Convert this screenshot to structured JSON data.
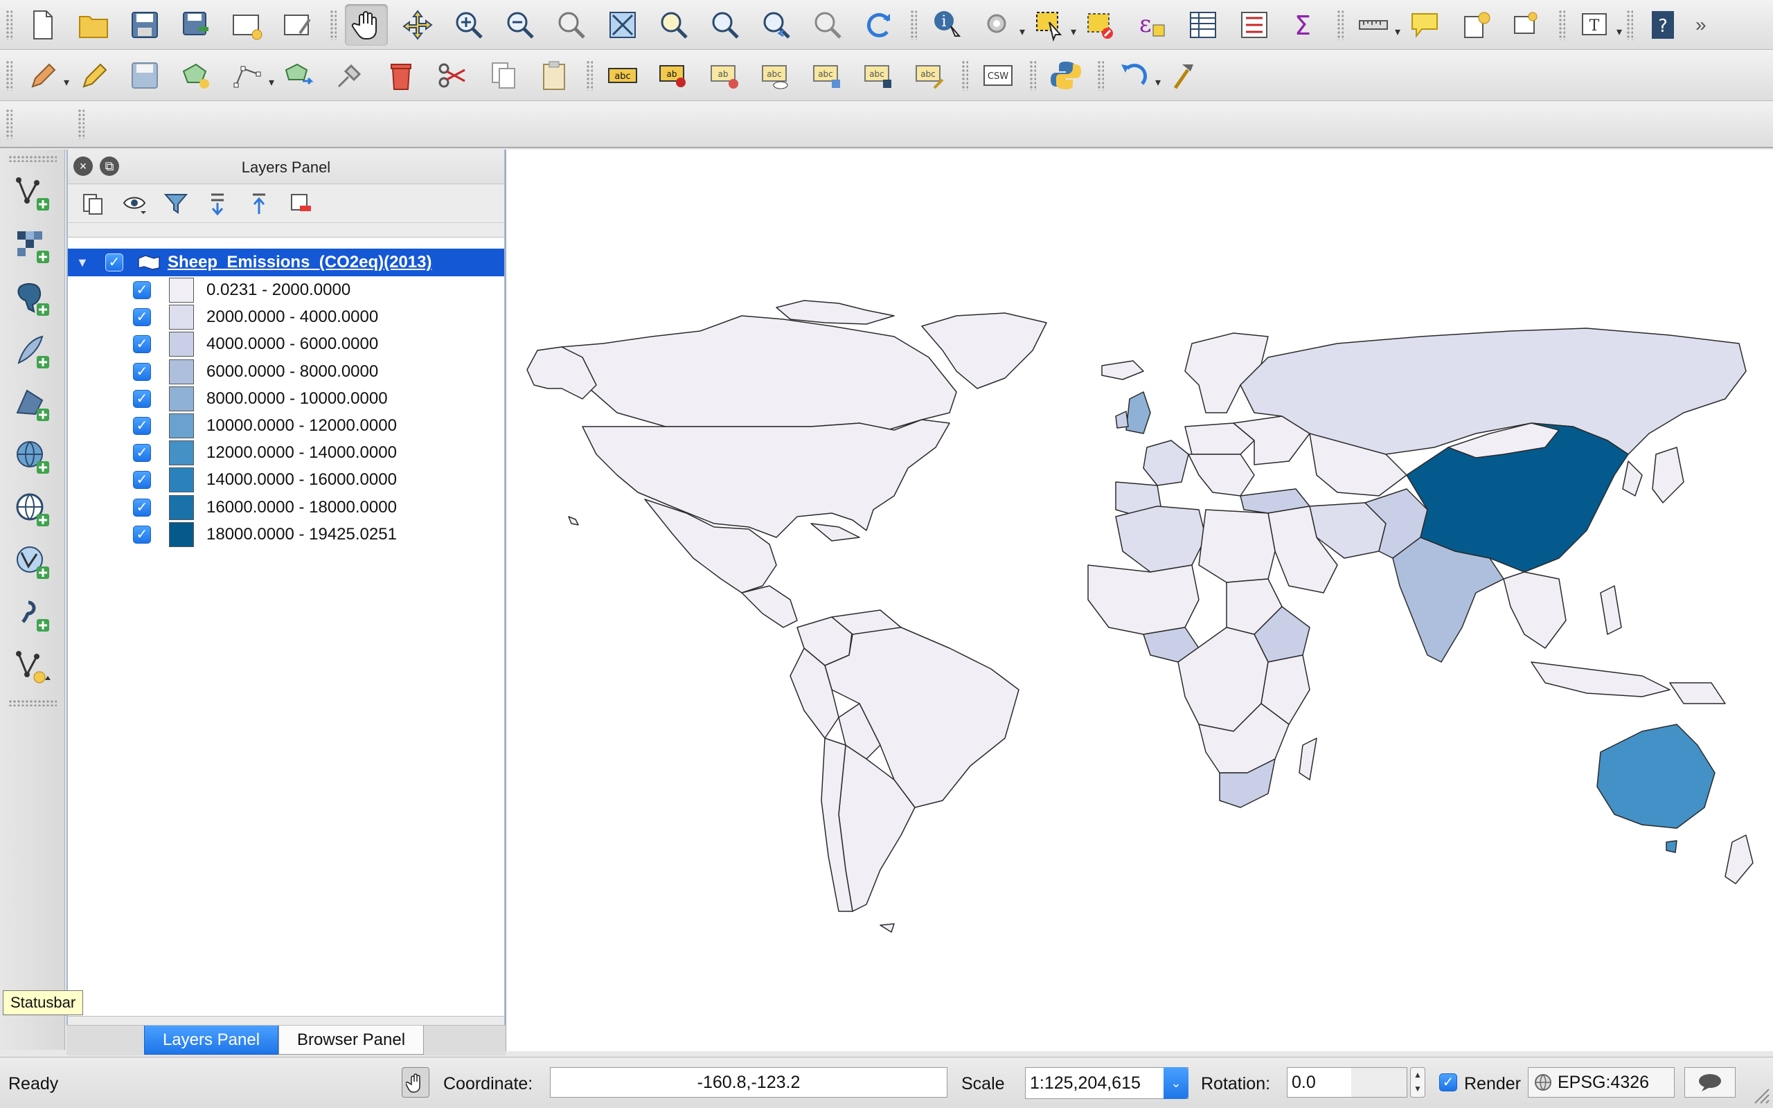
{
  "toolbars": {
    "row1": [
      "new-project",
      "open-project",
      "save-project",
      "save-as",
      "new-print-composer",
      "composer-manager",
      "pan-map",
      "pan-to-selection",
      "zoom-in",
      "zoom-out",
      "zoom-native",
      "zoom-full",
      "zoom-to-selection",
      "zoom-to-layer",
      "zoom-last",
      "zoom-next",
      "refresh",
      "identify",
      "action",
      "select-features",
      "deselect",
      "expression-select",
      "attribute-table",
      "statistical-summary",
      "field-calculator",
      "measure",
      "map-tips",
      "new-bookmark",
      "show-bookmarks",
      "text-annotation",
      "help"
    ],
    "row2": [
      "current-edits",
      "toggle-editing",
      "save-layer-edits",
      "add-feature",
      "node-tool",
      "move-feature",
      "digitize",
      "delete-selected",
      "cut-features",
      "copy-features",
      "paste-features",
      "label-tool",
      "pin-labels",
      "show-hide-labels",
      "move-label",
      "rotate-label",
      "change-label",
      "csw-search",
      "python-console",
      "undo",
      "processing-toolbox"
    ]
  },
  "left_toolbar": [
    "add-vector-layer",
    "add-raster-layer",
    "add-postgis-layer",
    "add-spatialite-layer",
    "add-mssql-layer",
    "add-wms-layer",
    "add-wcs-layer",
    "add-wfs-layer",
    "add-delimited-text-layer",
    "new-shapefile-layer"
  ],
  "layers_panel": {
    "title": "Layers Panel",
    "toolbar": [
      "add-group",
      "manage-visibility",
      "filter-legend",
      "expand-all",
      "collapse-all",
      "remove-layer"
    ],
    "layer": {
      "name": "Sheep_Emissions_(CO2eq)(2013)",
      "checked": true,
      "legend": [
        {
          "label": "0.0231 - 2000.0000",
          "color": "#f1eef6"
        },
        {
          "label": "2000.0000 - 4000.0000",
          "color": "#dddfef"
        },
        {
          "label": "4000.0000 - 6000.0000",
          "color": "#c9cfe6"
        },
        {
          "label": "6000.0000 - 8000.0000",
          "color": "#aebfde"
        },
        {
          "label": "8000.0000 - 10000.0000",
          "color": "#8fb1d6"
        },
        {
          "label": "10000.0000 - 12000.0000",
          "color": "#6aa2cf"
        },
        {
          "label": "12000.0000 - 14000.0000",
          "color": "#4391c6"
        },
        {
          "label": "14000.0000 - 16000.0000",
          "color": "#2a82bd"
        },
        {
          "label": "16000.0000 - 18000.0000",
          "color": "#1a72ab"
        },
        {
          "label": "18000.0000 - 19425.0251",
          "color": "#045a8d"
        }
      ]
    }
  },
  "dock_tabs": {
    "layers": "Layers Panel",
    "browser": "Browser Panel"
  },
  "tooltip": "Statusbar",
  "status_bar": {
    "status": "Ready",
    "coordinate_label": "Coordinate:",
    "coordinate_value": "-160.8,-123.2",
    "scale_label": "Scale",
    "scale_value": "1:125,204,615",
    "rotation_label": "Rotation:",
    "rotation_value": "0.0",
    "render_label": "Render",
    "render_checked": true,
    "crs": "EPSG:4326"
  }
}
